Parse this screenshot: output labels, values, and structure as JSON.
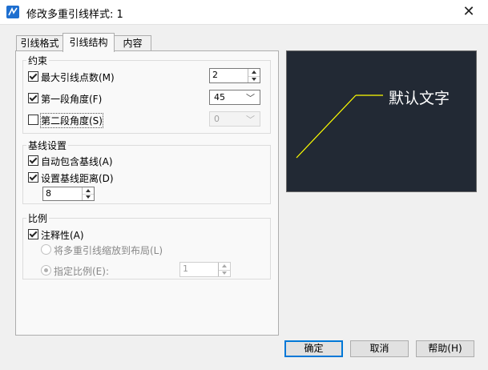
{
  "window": {
    "title": "修改多重引线样式: 1",
    "close_glyph": "✕"
  },
  "tabs": [
    {
      "label": "引线格式",
      "active": false
    },
    {
      "label": "引线结构",
      "active": true
    },
    {
      "label": "内容",
      "active": false
    }
  ],
  "constraints": {
    "group_label": "约束",
    "max_points": {
      "label": "最大引线点数(M)",
      "checked": true,
      "value": "2"
    },
    "first_angle": {
      "label": "第一段角度(F)",
      "checked": true,
      "value": "45"
    },
    "second_angle": {
      "label": "第二段角度(S)",
      "checked": false,
      "value": "0"
    }
  },
  "landing": {
    "group_label": "基线设置",
    "auto_include": {
      "label": "自动包含基线(A)",
      "checked": true
    },
    "set_distance": {
      "label": "设置基线距离(D)",
      "checked": true,
      "value": "8"
    }
  },
  "scale": {
    "group_label": "比例",
    "annotative": {
      "label": "注释性(A)",
      "checked": true
    },
    "scale_to_layout": {
      "label": "将多重引线缩放到布局(L)"
    },
    "specify_scale": {
      "label": "指定比例(E):",
      "value": "1"
    }
  },
  "preview": {
    "text": "默认文字",
    "bg_color": "#222934",
    "leader_color": "#ffff00"
  },
  "buttons": {
    "ok": "确定",
    "cancel": "取消",
    "help": "帮助(H)"
  },
  "icons": {
    "app": "autocad-app-icon",
    "close": "close-icon"
  }
}
